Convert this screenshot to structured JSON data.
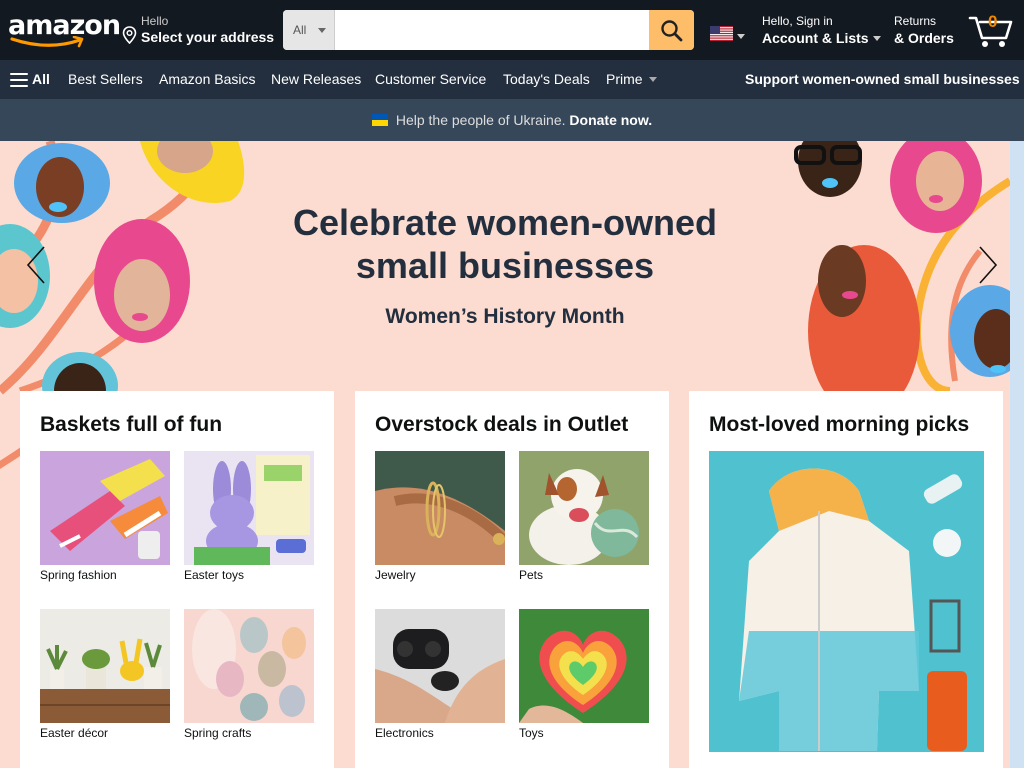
{
  "header": {
    "logo_text": "amazon",
    "address_line1": "Hello",
    "address_line2": "Select your address",
    "search_category": "All",
    "search_placeholder": "",
    "account_line1": "Hello, Sign in",
    "account_line2": "Account & Lists",
    "returns_line1": "Returns",
    "returns_line2": "& Orders",
    "cart_count": "0"
  },
  "subnav": {
    "all": "All",
    "items": [
      "Best Sellers",
      "Amazon Basics",
      "New Releases",
      "Customer Service",
      "Today's Deals",
      "Prime"
    ],
    "promo": "Support women-owned small businesses"
  },
  "banner": {
    "text": "Help the people of Ukraine.",
    "link": "Donate now."
  },
  "hero": {
    "title_line1": "Celebrate women-owned",
    "title_line2": "small businesses",
    "subtitle": "Women’s History Month"
  },
  "cards": [
    {
      "title": "Baskets full of fun",
      "tiles": [
        "Spring fashion",
        "Easter toys",
        "Easter décor",
        "Spring crafts"
      ]
    },
    {
      "title": "Overstock deals in Outlet",
      "tiles": [
        "Jewelry",
        "Pets",
        "Electronics",
        "Toys"
      ]
    },
    {
      "title": "Most-loved morning picks"
    }
  ],
  "colors": {
    "nav_dark": "#131921",
    "nav_sub": "#232f3e",
    "banner": "#37475a",
    "search_button": "#febd69",
    "cart_count": "#f08804",
    "hero_bg": "#fcdcd0"
  }
}
